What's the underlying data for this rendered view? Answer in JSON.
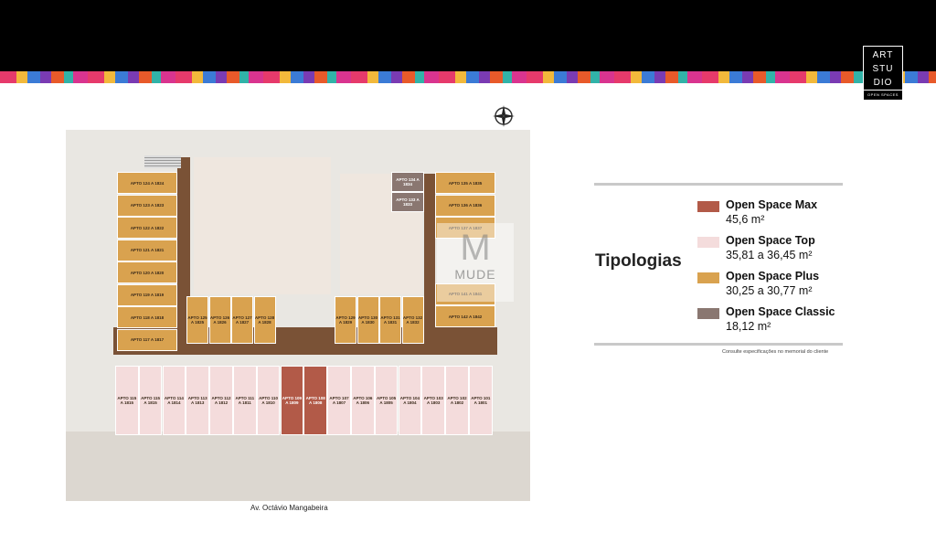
{
  "header": {
    "logo_line1": "ART",
    "logo_line2": "STU",
    "logo_line3": "DIO",
    "logo_sub": "OPEN SPACES"
  },
  "plan": {
    "street_label": "Av. Octávio Mangabeira",
    "watermark_initial": "M",
    "watermark_text": "MUDE",
    "units_left_column": [
      {
        "label": "APTO 124 A 1824",
        "type": "plus"
      },
      {
        "label": "APTO 123 A 1823",
        "type": "plus"
      },
      {
        "label": "APTO 122 A 1822",
        "type": "plus"
      },
      {
        "label": "APTO 121 A 1821",
        "type": "plus"
      },
      {
        "label": "APTO 120 A 1820",
        "type": "plus"
      },
      {
        "label": "APTO 119 A 1819",
        "type": "plus"
      },
      {
        "label": "APTO 118 A 1818",
        "type": "plus"
      },
      {
        "label": "APTO 117 A 1817",
        "type": "plus"
      }
    ],
    "units_right_column": [
      {
        "label": "APTO 134 A 1834",
        "type": "classic"
      },
      {
        "label": "APTO 133 A 1833",
        "type": "classic"
      },
      {
        "label": "APTO 135 A 1835",
        "type": "plus"
      },
      {
        "label": "APTO 136 A 1836",
        "type": "plus"
      },
      {
        "label": "APTO 137 A 1837",
        "type": "plus"
      },
      {
        "label": "APTO 141 A 1841",
        "type": "plus"
      },
      {
        "label": "APTO 142 A 1842",
        "type": "plus"
      }
    ],
    "units_middle_left": [
      {
        "label": "APTO 125 A 1825",
        "type": "plus"
      },
      {
        "label": "APTO 126 A 1826",
        "type": "plus"
      },
      {
        "label": "APTO 127 A 1827",
        "type": "plus"
      },
      {
        "label": "APTO 128 A 1828",
        "type": "plus"
      }
    ],
    "units_middle_right": [
      {
        "label": "APTO 129 A 1829",
        "type": "plus"
      },
      {
        "label": "APTO 130 A 1830",
        "type": "plus"
      },
      {
        "label": "APTO 131 A 1831",
        "type": "plus"
      },
      {
        "label": "APTO 132 A 1832",
        "type": "plus"
      }
    ],
    "units_bottom_row": [
      {
        "label": "APTO 115 A 1815",
        "type": "top"
      },
      {
        "label": "APTO 115 A 1815",
        "type": "top"
      },
      {
        "label": "APTO 114 A 1814",
        "type": "top"
      },
      {
        "label": "APTO 113 A 1813",
        "type": "top"
      },
      {
        "label": "APTO 112 A 1812",
        "type": "top"
      },
      {
        "label": "APTO 111 A 1811",
        "type": "top"
      },
      {
        "label": "APTO 110 A 1810",
        "type": "top"
      },
      {
        "label": "APTO 109 A 1809",
        "type": "max"
      },
      {
        "label": "APTO 108 A 1808",
        "type": "max"
      },
      {
        "label": "APTO 107 A 1807",
        "type": "top"
      },
      {
        "label": "APTO 106 A 1806",
        "type": "top"
      },
      {
        "label": "APTO 105 A 1805",
        "type": "top"
      },
      {
        "label": "APTO 104 A 1804",
        "type": "top"
      },
      {
        "label": "APTO 103 A 1803",
        "type": "top"
      },
      {
        "label": "APTO 102 A 1802",
        "type": "top"
      },
      {
        "label": "APTO 101 A 1801",
        "type": "top"
      }
    ]
  },
  "legend": {
    "title": "Tipologias",
    "items": [
      {
        "name": "Open Space Max",
        "size": "45,6 m²",
        "color": "#b25a48"
      },
      {
        "name": "Open Space Top",
        "size": "35,81 a 36,45 m²",
        "color": "#f4dcdc"
      },
      {
        "name": "Open Space Plus",
        "size": "30,25 a 30,77 m²",
        "color": "#d9a24f"
      },
      {
        "name": "Open Space Classic",
        "size": "18,12 m²",
        "color": "#8a7771"
      }
    ],
    "note": "Consulte especificações no memorial do cliente"
  },
  "icons": {
    "compass": "compass-icon"
  }
}
